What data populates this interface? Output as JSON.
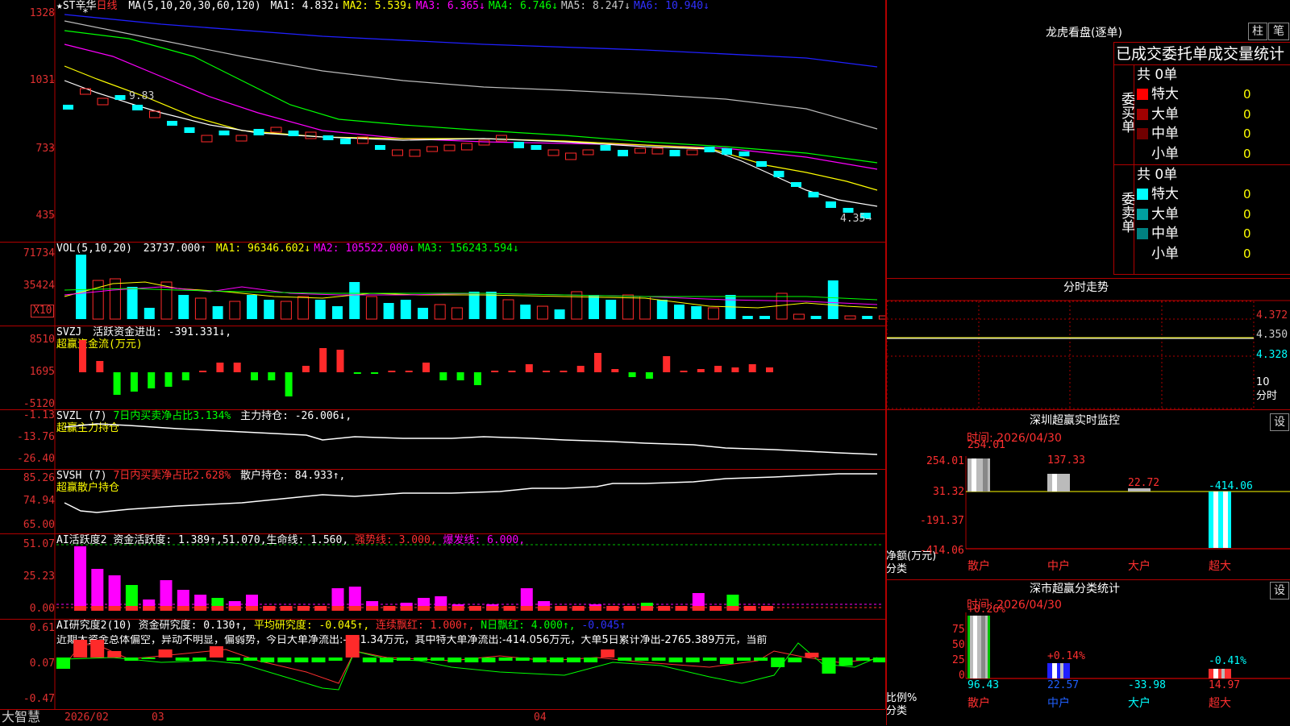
{
  "main": {
    "stock_name": "★ST辛华",
    "period": "日线",
    "ma_label": "MA(5,10,20,30,60,120)",
    "ma_values": [
      {
        "k": "MA1:",
        "v": "4.832↓",
        "c": "#ffffff"
      },
      {
        "k": "MA2:",
        "v": "5.539↓",
        "c": "#ffff00"
      },
      {
        "k": "MA3:",
        "v": "6.365↓",
        "c": "#ff00ff"
      },
      {
        "k": "MA4:",
        "v": "6.746↓",
        "c": "#00ff00"
      },
      {
        "k": "MA5:",
        "v": "8.247↓",
        "c": "#c8c8c8"
      },
      {
        "k": "MA6:",
        "v": "10.940↓",
        "c": "#3030ff"
      }
    ],
    "y_ticks": [
      "1328",
      "1031",
      "733",
      "435"
    ],
    "max_label": "9.83",
    "last_label": "4.35→"
  },
  "vol": {
    "label": "VOL(5,10,20)",
    "value": "23737.000↑",
    "ma": [
      {
        "k": "MA1:",
        "v": "96346.602↓",
        "c": "#ffff00"
      },
      {
        "k": "MA2:",
        "v": "105522.000↓",
        "c": "#ff00ff"
      },
      {
        "k": "MA3:",
        "v": "156243.594↓",
        "c": "#00ff00"
      }
    ],
    "y_ticks": [
      "71734",
      "35424"
    ],
    "unit": "X10"
  },
  "svzj": {
    "label": "SVZJ",
    "desc": "活跃资金进出: -391.331↓,",
    "sub": "超赢资金流(万元)",
    "y_ticks": [
      "8510",
      "1695",
      "-5120"
    ]
  },
  "svzl": {
    "label": "SVZL (7)",
    "desc1": "7日内买卖净占比3.134%",
    "desc2": "主力持仓: -26.006↓,",
    "sub": "超赢主力持仓",
    "y_ticks": [
      "-1.13",
      "-13.76",
      "-26.40"
    ]
  },
  "svsh": {
    "label": "SVSH (7)",
    "desc1": "7日内买卖净占比2.628%",
    "desc2": "散户持仓: 84.933↑,",
    "sub": "超赢散户持仓",
    "y_ticks": [
      "85.26",
      "74.94",
      "65.00"
    ]
  },
  "ai1": {
    "label": "AI活跃度2",
    "desc": "资金活跃度: 1.389↑,51.070,生命线: 1.560,",
    "strong": "强势线: 3.000,",
    "burst": "爆发线: 6.000,",
    "y_ticks": [
      "51.07",
      "25.23",
      "0.00"
    ]
  },
  "ai2": {
    "label": "AI研究度2(10)",
    "desc": "资金研究度: 0.130↑,",
    "avg": "平均研究度: -0.045↑,",
    "cont": "连续飘红: 1.000↑,",
    "nday": "N日飘红: 4.000↑,",
    "last": "-0.045↑",
    "comment": "近期大资金总体偏空，异动不明显，偏弱势，今日大单净流出:-391.34万元，其中特大单净流出:-414.056万元，大单5日累计净出-2765.389万元，当前",
    "y_ticks": [
      "0.61",
      "0.07",
      "-0.47"
    ]
  },
  "footer": {
    "brand": "大智慧",
    "dates": [
      "2026/02",
      "03",
      "04"
    ]
  },
  "right": {
    "title": "龙虎看盘(逐单)",
    "btn_bar": "柱",
    "btn_pen": "笔",
    "stats_title": "已成交委托单成交量统计",
    "buy_label": "委买单",
    "sell_label": "委卖单",
    "buy_total": "共 0单",
    "sell_total": "共 0单",
    "buy_rows": [
      {
        "name": "特大",
        "val": "0",
        "color": "#ff0000"
      },
      {
        "name": "大单",
        "val": "0",
        "color": "#a00000"
      },
      {
        "name": "中单",
        "val": "0",
        "color": "#700000"
      },
      {
        "name": "小单",
        "val": "0",
        "color": ""
      }
    ],
    "sell_rows": [
      {
        "name": "特大",
        "val": "0",
        "color": "#00ffff"
      },
      {
        "name": "大单",
        "val": "0",
        "color": "#00a0a0"
      },
      {
        "name": "中单",
        "val": "0",
        "color": "#008080"
      },
      {
        "name": "小单",
        "val": "0",
        "color": ""
      }
    ],
    "intraday_title": "分时走势",
    "intraday_ticks": [
      "4.372",
      "4.350",
      "4.328"
    ],
    "intraday_unit": "10",
    "intraday_unit2": "分时",
    "monitor_title": "深圳超赢实时监控",
    "monitor_date": "时间: 2026/04/30",
    "monitor_btn": "设",
    "monitor_ticks": [
      "254.01",
      "31.32",
      "-191.37",
      "-414.06"
    ],
    "monitor_ylabel": "净额(万元)",
    "monitor_xlabel": "分类",
    "monitor_cats": [
      "散户",
      "中户",
      "大户",
      "超大"
    ],
    "monitor_vals": [
      "254.01",
      "137.33",
      "22.72",
      "-414.06"
    ],
    "class_title": "深市超赢分类统计",
    "class_date": "时间: 2026/04/30",
    "class_btn": "设",
    "class_ticks": [
      "75",
      "50",
      "25",
      "0"
    ],
    "class_pct": [
      "+0.26%",
      "+0.14%",
      "-0.41%"
    ],
    "class_vals": [
      "96.43",
      "22.57",
      "-33.98",
      "14.97"
    ],
    "class_ylabel": "比例%",
    "class_xlabel": "分类",
    "class_cats": [
      "散户",
      "中户",
      "大户",
      "超大"
    ]
  },
  "colors": {
    "up": "#ff2a2a",
    "down": "#00ffff",
    "grid": "#b00000"
  }
}
